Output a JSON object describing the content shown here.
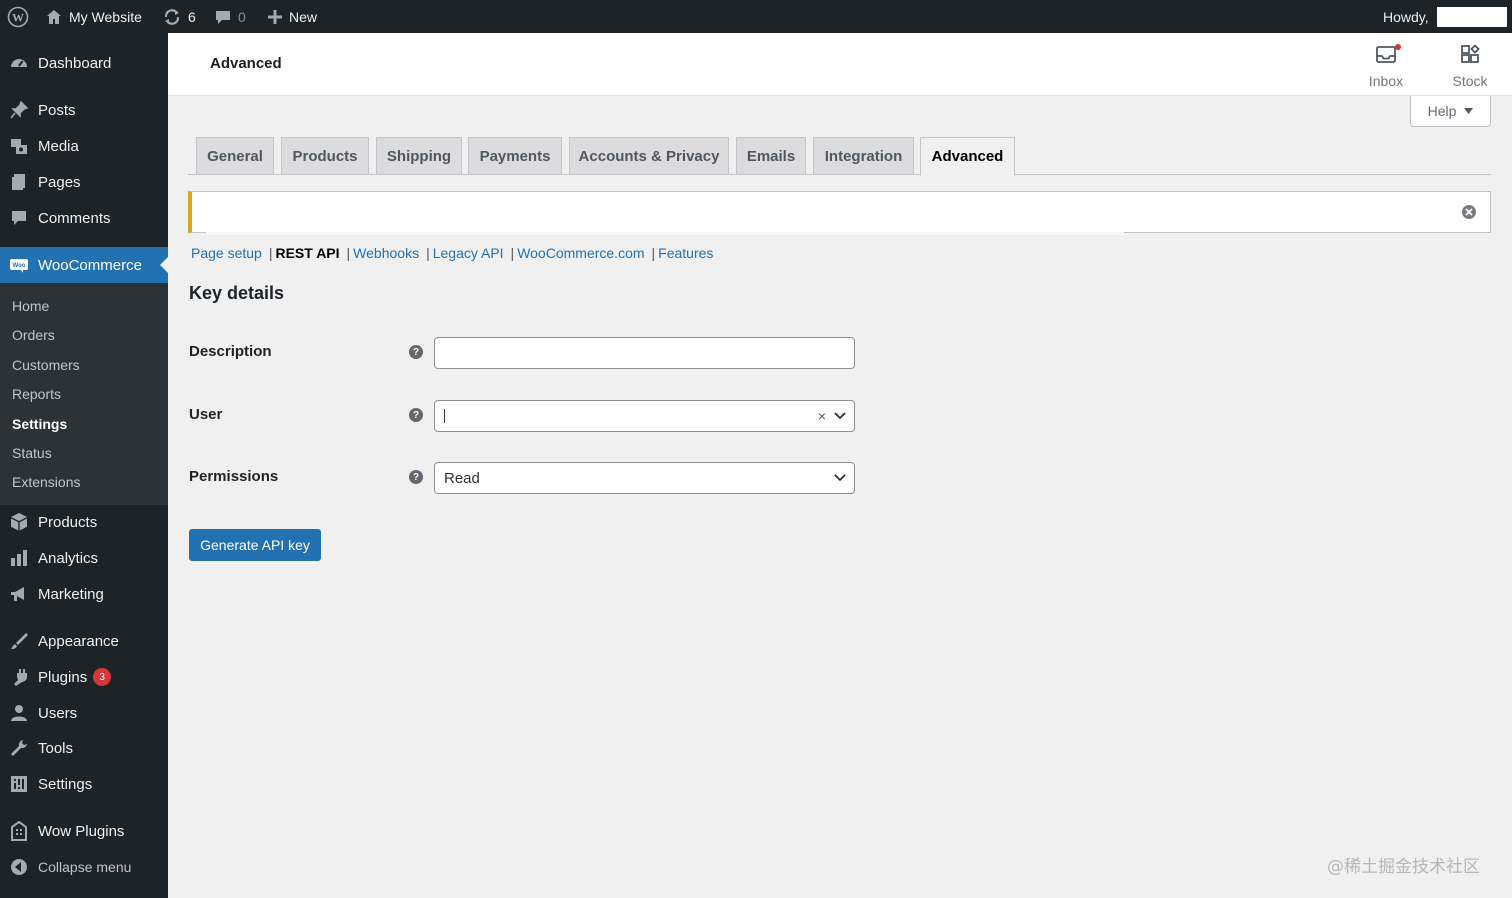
{
  "adminbar": {
    "site_name": "My Website",
    "updates_count": "6",
    "comments_count": "0",
    "new_label": "New",
    "howdy": "Howdy,"
  },
  "sidebar": {
    "items": [
      {
        "label": "Dashboard",
        "icon": "dashboard-icon"
      },
      {
        "label": "Posts",
        "icon": "pin-icon"
      },
      {
        "label": "Media",
        "icon": "media-icon"
      },
      {
        "label": "Pages",
        "icon": "pages-icon"
      },
      {
        "label": "Comments",
        "icon": "comment-icon"
      },
      {
        "label": "WooCommerce",
        "icon": "woo-icon"
      },
      {
        "label": "Products",
        "icon": "archive-icon"
      },
      {
        "label": "Analytics",
        "icon": "chart-icon"
      },
      {
        "label": "Marketing",
        "icon": "megaphone-icon"
      },
      {
        "label": "Appearance",
        "icon": "brush-icon"
      },
      {
        "label": "Plugins",
        "icon": "plugin-icon",
        "badge": "3"
      },
      {
        "label": "Users",
        "icon": "user-icon"
      },
      {
        "label": "Tools",
        "icon": "wrench-icon"
      },
      {
        "label": "Settings",
        "icon": "settings-icon"
      },
      {
        "label": "Wow Plugins",
        "icon": "building-icon"
      }
    ],
    "submenu": [
      "Home",
      "Orders",
      "Customers",
      "Reports",
      "Settings",
      "Status",
      "Extensions"
    ],
    "collapse": "Collapse menu"
  },
  "header": {
    "title": "Advanced",
    "inbox_label": "Inbox",
    "stock_label": "Stock",
    "help_label": "Help"
  },
  "tabs": [
    "General",
    "Products",
    "Shipping",
    "Payments",
    "Accounts & Privacy",
    "Emails",
    "Integration",
    "Advanced"
  ],
  "sections": {
    "page_setup": "Page setup",
    "rest_api": "REST API",
    "webhooks": "Webhooks",
    "legacy_api": "Legacy API",
    "woocommerce_com": "WooCommerce.com",
    "features": "Features",
    "separator": "|"
  },
  "form": {
    "title": "Key details",
    "description_label": "Description",
    "description_value": "",
    "user_label": "User",
    "user_value": "",
    "permissions_label": "Permissions",
    "permissions_value": "Read",
    "help_glyph": "?",
    "clear_glyph": "×",
    "submit": "Generate API key"
  },
  "watermark": "@稀土掘金技术社区",
  "colors": {
    "admin_dark": "#1d2327",
    "primary_blue": "#2271b1",
    "notice_yellow": "#dba617",
    "badge_red": "#d63638"
  }
}
